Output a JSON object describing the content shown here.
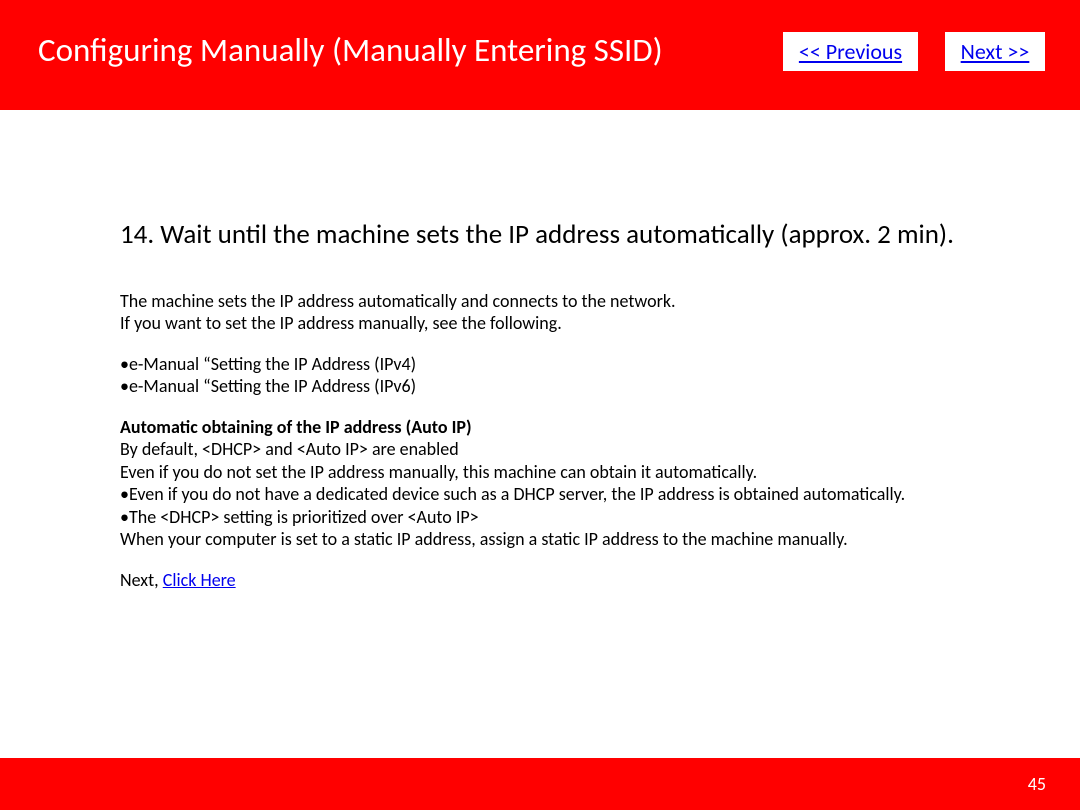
{
  "header": {
    "title": "Configuring Manually (Manually Entering SSID)",
    "prev_label": "<< Previous",
    "next_label": "Next >>"
  },
  "content": {
    "step_heading": "14. Wait until the machine sets the IP address automatically (approx. 2 min).",
    "intro1": "The machine sets the IP address automatically and connects to the network.",
    "intro2": "If you want to set the IP address manually, see the following.",
    "ref1": "•e-Manual “Setting the IP Address (IPv4)",
    "ref2": "•e-Manual “Setting the IP Address (IPv6)",
    "sub_heading": "Automatic obtaining of the IP address (Auto IP)",
    "line1": "By default, <DHCP> and <Auto IP> are enabled",
    "line2": "Even if you do not set the IP address manually, this machine can obtain it automatically.",
    "line3": "•Even if you do not have a dedicated device such as a DHCP server, the IP address is obtained automatically.",
    "line4": "•The <DHCP> setting is prioritized over <Auto IP>",
    "line5": "When your computer is set to a static IP address, assign a static IP address to the machine manually.",
    "next_prefix": "Next, ",
    "next_link": "Click Here"
  },
  "footer": {
    "page_number": "45"
  }
}
